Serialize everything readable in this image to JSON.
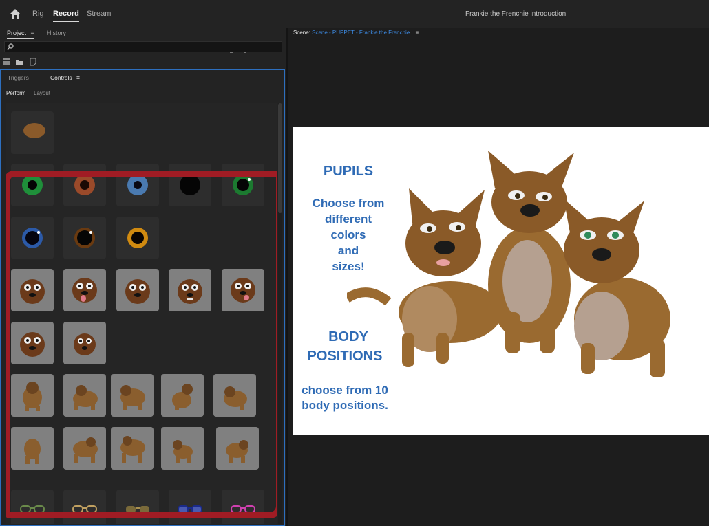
{
  "topbar": {
    "workspaces": [
      "Rig",
      "Record",
      "Stream"
    ],
    "active_workspace": "Record",
    "document_title": "Frankie the Frenchie introduction"
  },
  "project_panel": {
    "tabs": [
      "Project",
      "History"
    ],
    "active_tab": "Project",
    "search_placeholder": ""
  },
  "controls_panel": {
    "tabs": [
      "Triggers",
      "Controls"
    ],
    "active_tab": "Controls",
    "subtabs": [
      "Perform",
      "Layout"
    ],
    "active_subtab": "Perform",
    "groups": [
      {
        "name": "head",
        "items": [
          "head-shape"
        ]
      },
      {
        "name": "pupils",
        "items": [
          "green-pupil",
          "brown-pupil",
          "blue-pupil",
          "black-pupil",
          "green-ring-pupil",
          "blue-ring-pupil",
          "dark-ring-pupil",
          "gold-pupil"
        ]
      },
      {
        "name": "faces",
        "items": [
          "face-neutral",
          "face-tongue",
          "face-smile",
          "face-grin",
          "face-tongue-side",
          "face-calm",
          "face-small"
        ]
      },
      {
        "name": "body-positions",
        "items": [
          "body-1",
          "body-2",
          "body-3",
          "body-4",
          "body-5",
          "body-6",
          "body-7",
          "body-8",
          "body-9",
          "body-10"
        ]
      },
      {
        "name": "glasses",
        "items": [
          "glasses-green",
          "glasses-gold",
          "glasses-sun",
          "glasses-blue",
          "glasses-pink"
        ]
      }
    ]
  },
  "scene": {
    "label": "Scene:",
    "name": "Scene - PUPPET - Frankie the Frenchie",
    "stage_text": {
      "pupils_title": "PUPILS",
      "pupils_lines": [
        "Choose from",
        "different",
        "colors",
        "and",
        "sizes!"
      ],
      "body_title_lines": [
        "BODY",
        "POSITIONS"
      ],
      "body_lines": [
        "choose from 10",
        "body positions."
      ]
    }
  },
  "colors": {
    "accent_blue": "#3d8ce6",
    "stage_text_blue": "#2f6bb5",
    "highlight_red": "#a01c24",
    "panel_bg": "#232323"
  }
}
